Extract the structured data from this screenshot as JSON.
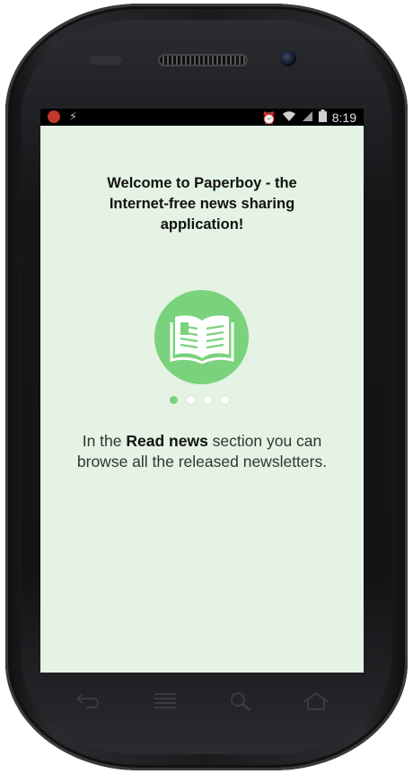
{
  "status_bar": {
    "time": "8:19",
    "icons": [
      "record-icon",
      "usb-icon",
      "alarm-icon",
      "wifi-icon",
      "signal-icon",
      "battery-icon"
    ]
  },
  "intro": {
    "welcome_line1": "Welcome to Paperboy - the",
    "welcome_line2": "Internet-free news sharing",
    "welcome_line3": "application!",
    "logo_icon": "open-book-icon",
    "pager": {
      "current": 1,
      "total": 4
    },
    "desc_prefix": "In the ",
    "desc_bold": "Read news",
    "desc_suffix": " section you can browse all the released newsletters."
  },
  "nav_keys": [
    "back-icon",
    "menu-icon",
    "search-icon",
    "home-icon"
  ],
  "colors": {
    "screen_bg": "#e4f3e4",
    "accent": "#7bd27c"
  }
}
